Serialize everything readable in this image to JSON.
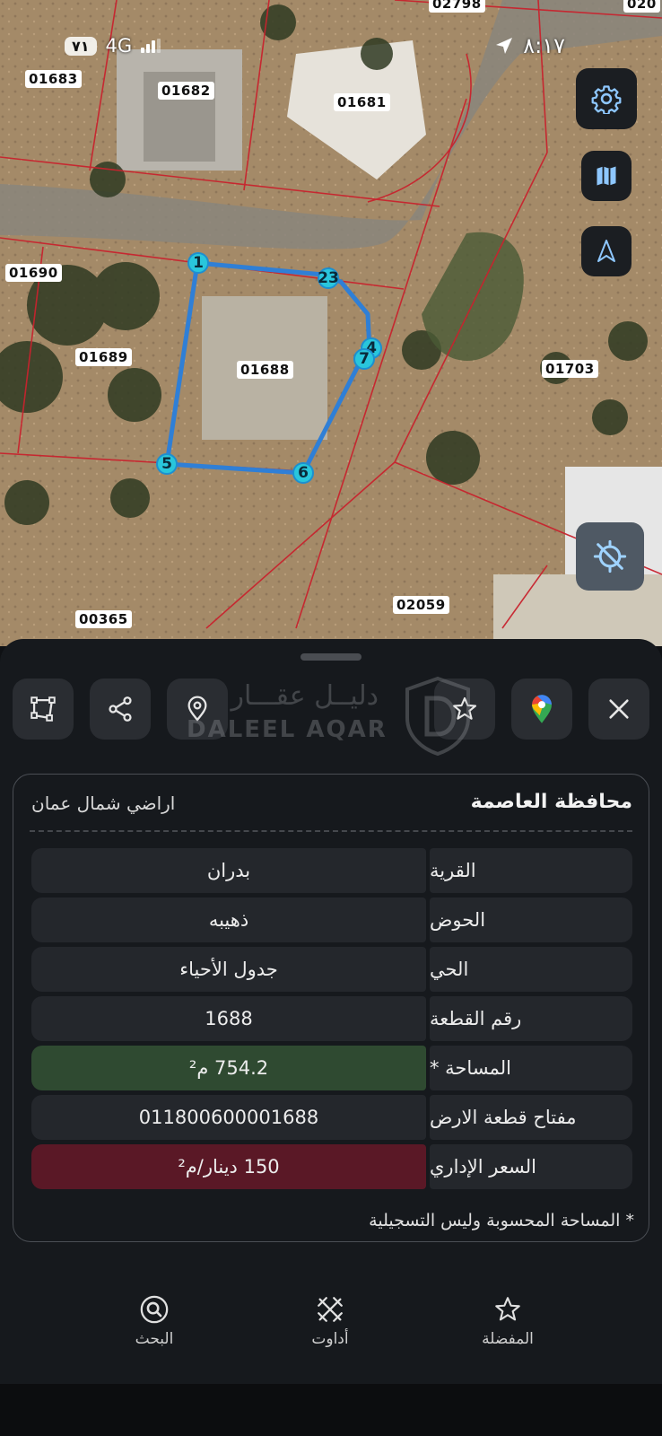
{
  "status_bar": {
    "battery": "٧١",
    "network": "4G",
    "time": "٨:١٧"
  },
  "map": {
    "parcels": [
      "02798",
      "020",
      "01683",
      "01682",
      "01681",
      "01690",
      "01689",
      "01688",
      "01703",
      "02059",
      "00365"
    ],
    "vertices": [
      "1",
      "23",
      "4",
      "7",
      "5",
      "6"
    ],
    "buttons": {
      "settings": "gear-icon",
      "layers": "map-icon",
      "compass": "north-arrow-icon",
      "locate": "gps-off-icon"
    }
  },
  "toolbar": {
    "icons": [
      "polygon-icon",
      "share-icon",
      "pin-icon",
      "star-icon",
      "google-maps-icon",
      "close-icon"
    ]
  },
  "watermark": {
    "arabic": "دليــل عقـــار",
    "english": "DALEEL AQAR"
  },
  "details": {
    "governorate": "محافظة العاصمة",
    "area": "اراضي شمال عمان",
    "rows": [
      {
        "label": "القرية",
        "value": "بدران"
      },
      {
        "label": "الحوض",
        "value": "ذهيبه"
      },
      {
        "label": "الحي",
        "value": "جدول الأحياء"
      },
      {
        "label": "رقم القطعة",
        "value": "1688"
      },
      {
        "label": "المساحة *",
        "value": "754.2 م²"
      },
      {
        "label": "مفتاح قطعة الارض",
        "value": "011800600001688"
      },
      {
        "label": "السعر الإداري",
        "value": "150 دينار/م²"
      }
    ],
    "note": "* المساحة المحسوبة وليس التسجيلية"
  },
  "nav": {
    "search": "البحث",
    "tools": "أداوت",
    "favorites": "المفضلة"
  },
  "colors": {
    "area_bg": "#2f4a31",
    "price_bg": "#5a1826",
    "parcel_outline": "#2f7fd6",
    "vertex": "#29c6dc",
    "cadastre_lines": "#c8232e"
  }
}
